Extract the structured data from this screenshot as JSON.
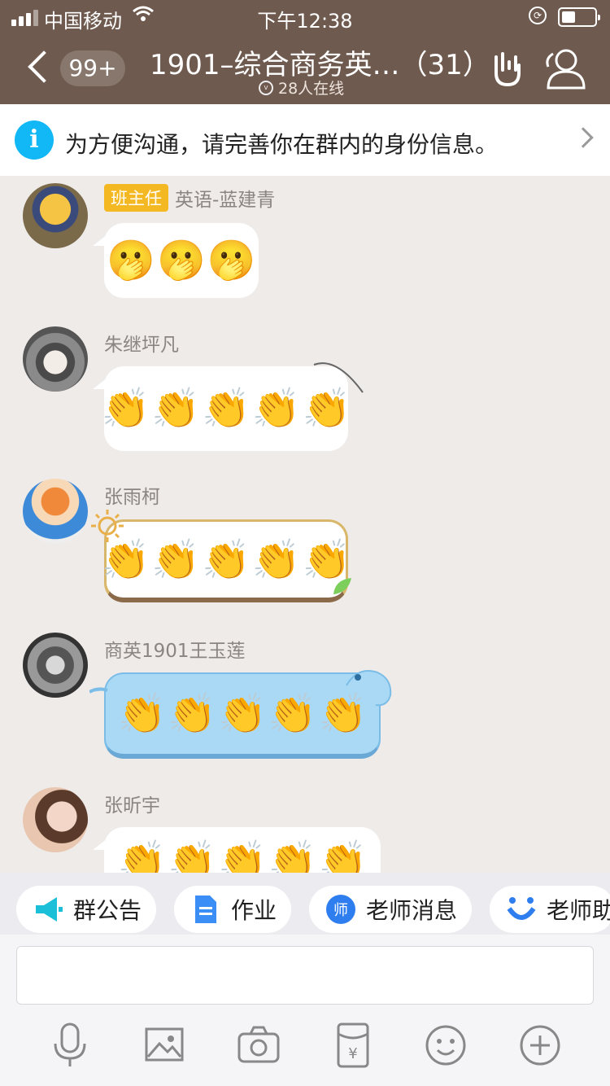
{
  "status_bar": {
    "carrier": "中国移动",
    "time": "下午12:38"
  },
  "header": {
    "unread_count": "99+",
    "title": "1901–综合商务英…（31）",
    "online_text": "28人在线"
  },
  "notice": {
    "text": "为方便沟通，请完善你在群内的身份信息。"
  },
  "messages": [
    {
      "role_badge": "班主任",
      "sender": "英语-蓝建青",
      "emojis": [
        "🫢",
        "🫢",
        "🫢"
      ]
    },
    {
      "sender": "朱继坪凡",
      "emojis": [
        "👏",
        "👏",
        "👏",
        "👏",
        "👏"
      ]
    },
    {
      "sender": "张雨柯",
      "emojis": [
        "👏",
        "👏",
        "👏",
        "👏",
        "👏"
      ]
    },
    {
      "sender": "商英1901王玉莲",
      "emojis": [
        "👏",
        "👏",
        "👏",
        "👏",
        "👏"
      ]
    },
    {
      "sender": "张昕宇",
      "emojis": [
        "👏",
        "👏",
        "👏",
        "👏",
        "👏"
      ]
    }
  ],
  "quick_actions": [
    {
      "label": "群公告",
      "icon": "megaphone-icon"
    },
    {
      "label": "作业",
      "icon": "document-icon"
    },
    {
      "label": "老师消息",
      "icon": "teacher-badge-icon"
    },
    {
      "label": "老师助",
      "icon": "assistant-icon"
    }
  ],
  "composer": {
    "input_value": "",
    "tools": [
      "microphone-icon",
      "image-icon",
      "camera-icon",
      "red-packet-icon",
      "emoji-icon",
      "plus-icon"
    ]
  },
  "colors": {
    "header_bg": "#6e5a4e",
    "chat_bg": "#efebe9",
    "info_blue": "#12b7f5",
    "badge_yellow": "#f4b823"
  }
}
